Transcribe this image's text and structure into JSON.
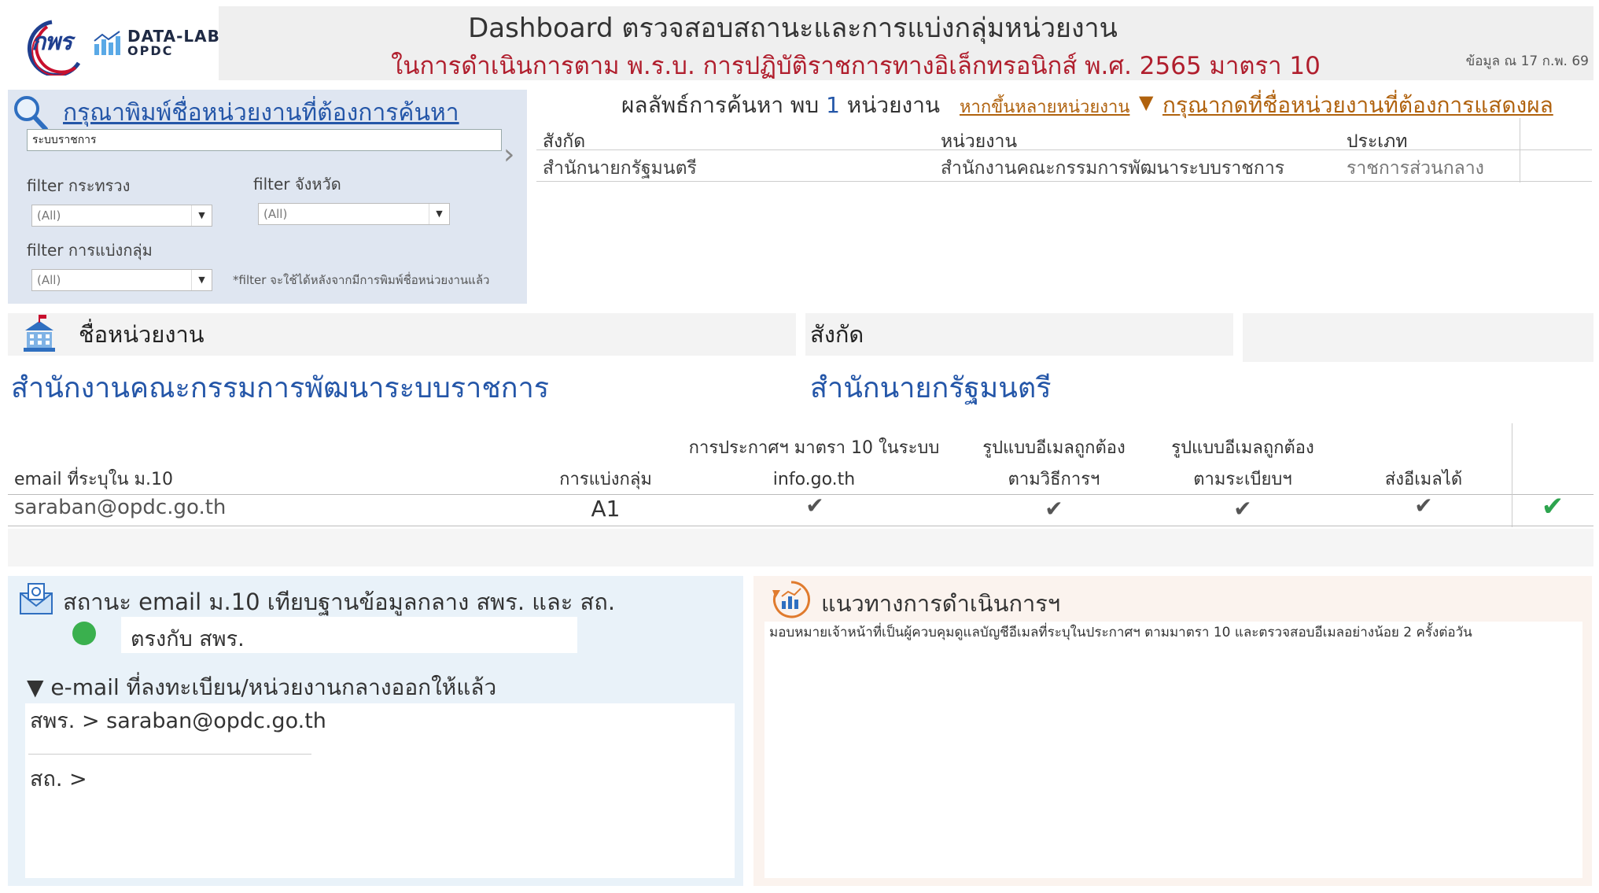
{
  "header": {
    "logo_text": "กพร",
    "datalab_title": "DATA-LAB",
    "datalab_sub": "OPDC",
    "title": "Dashboard ตรวจสอบสถานะและการแบ่งกลุ่มหน่วยงาน",
    "subtitle": "ในการดำเนินการตาม พ.ร.บ. การปฏิบัติราชการทางอิเล็กทรอนิกส์ พ.ศ. 2565 มาตรา 10",
    "date": "ข้อมูล ณ 17 ก.พ. 69"
  },
  "search": {
    "title": "กรุณาพิมพ์ชื่อหน่วยงานที่ต้องการค้นหา",
    "value": "ระบบราชการ",
    "filters": [
      {
        "label": "filter กระทรวง",
        "value": "(All)"
      },
      {
        "label": "filter จังหวัด",
        "value": "(All)"
      },
      {
        "label": "filter การแบ่งกลุ่ม",
        "value": "(All)"
      }
    ],
    "note": "*filter จะใช้ได้หลังจากมีการพิมพ์ชื่อหน่วยงานแล้ว"
  },
  "results": {
    "prefix": "ผลลัพธ์การค้นหา พบ ",
    "count": "1",
    "suffix": " หน่วยงาน",
    "link_multi": "หากขึ้นหลายหน่วยงาน",
    "link_select": "กรุณากดที่ชื่อหน่วยงานที่ต้องการแสดงผล",
    "columns": [
      "สังกัด",
      "หน่วยงาน",
      "ประเภท"
    ],
    "rows": [
      [
        "สำนักนายกรัฐมนตรี",
        "สำนักงานคณะกรรมการพัฒนาระบบราชการ",
        "ราชการส่วนกลาง"
      ]
    ]
  },
  "agency": {
    "label": "ชื่อหน่วยงาน",
    "name": "สำนักงานคณะกรรมการพัฒนาระบบราชการ",
    "parent_label": "สังกัด",
    "parent_name": "สำนักนายกรัฐมนตรี"
  },
  "email_table": {
    "headers": {
      "email": "email ที่ระบุใน ม.10",
      "group": "การแบ่งกลุ่ม",
      "announce_1": "การประกาศฯ มาตรา 10 ในระบบ",
      "announce_2": "info.go.th",
      "format_method_1": "รูปแบบอีเมลถูกต้อง",
      "format_method_2": "ตามวิธีการฯ",
      "format_reg_1": "รูปแบบอีเมลถูกต้อง",
      "format_reg_2": "ตามระเบียบฯ",
      "sendable": "ส่งอีเมลได้"
    },
    "row": {
      "email": "saraban@opdc.go.th",
      "group": "A1",
      "check": "✔",
      "final": "✔"
    }
  },
  "status": {
    "title": "สถานะ email ม.10 เทียบฐานข้อมูลกลาง สพร. และ สถ.",
    "match_text": "ตรงกับ สพร.",
    "match_color": "#3ab04e",
    "registered_title": "▼  e-mail ที่ลงทะเบียน/หน่วยงานกลางออกให้แล้ว",
    "line1": "สพร. > saraban@opdc.go.th",
    "line2": "สถ.  >"
  },
  "guidance": {
    "title": "แนวทางการดำเนินการฯ",
    "text": "มอบหมายเจ้าหน้าที่เป็นผู้ควบคุมดูแลบัญชีอีเมลที่ระบุในประกาศฯ ตามมาตรา 10 และตรวจสอบอีเมลอย่างน้อย 2 ครั้งต่อวัน"
  }
}
